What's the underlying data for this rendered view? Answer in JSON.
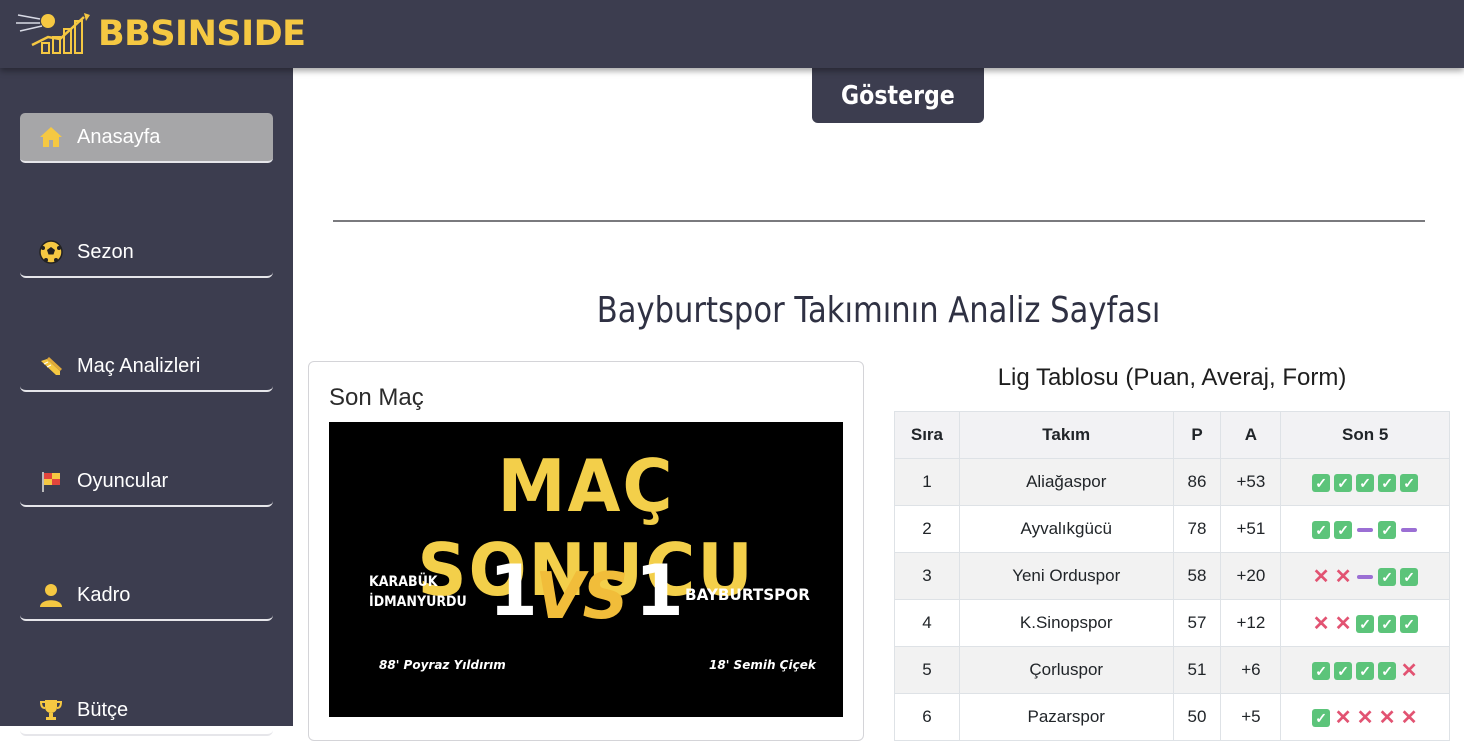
{
  "brand": {
    "name": "BBSINSIDE"
  },
  "colors": {
    "bar": "#3c3d4f",
    "brand": "#f5c842",
    "active": "#a6a6a8",
    "win": "#5cc47a",
    "loss": "#e25372",
    "draw": "#9b6fd4"
  },
  "sidebar": {
    "items": [
      {
        "label": "Anasayfa",
        "icon": "home-icon",
        "active": true
      },
      {
        "label": "Sezon",
        "icon": "soccer-ball-icon",
        "active": false
      },
      {
        "label": "Maç Analizleri",
        "icon": "cleat-icon",
        "active": false
      },
      {
        "label": "Oyuncular",
        "icon": "flag-icon",
        "active": false
      },
      {
        "label": "Kadro",
        "icon": "person-icon",
        "active": false
      },
      {
        "label": "Bütçe",
        "icon": "trophy-icon",
        "active": false
      }
    ]
  },
  "main": {
    "tab": "Gösterge",
    "title": "Bayburtspor Takımının Analiz Sayfası"
  },
  "last_match": {
    "card_title": "Son Maç",
    "header": "MAÇ SONUCU",
    "home_team": "KARABÜK\nİDMANYURDU",
    "home_score": "1",
    "vs": "VS",
    "away_score": "1",
    "away_team": "BAYBURTSPOR",
    "home_scorer": "88' Poyraz Yıldırım",
    "away_scorer": "18' Semih Çiçek"
  },
  "league_table": {
    "title": "Lig Tablosu (Puan, Averaj, Form)",
    "columns": [
      "Sıra",
      "Takım",
      "P",
      "A",
      "Son 5"
    ],
    "rows": [
      {
        "rank": "1",
        "team": "Aliağaspor",
        "points": "86",
        "average": "+53",
        "form": [
          "W",
          "W",
          "W",
          "W",
          "W"
        ]
      },
      {
        "rank": "2",
        "team": "Ayvalıkgücü",
        "points": "78",
        "average": "+51",
        "form": [
          "W",
          "W",
          "D",
          "W",
          "D"
        ]
      },
      {
        "rank": "3",
        "team": "Yeni Orduspor",
        "points": "58",
        "average": "+20",
        "form": [
          "L",
          "L",
          "D",
          "W",
          "W"
        ]
      },
      {
        "rank": "4",
        "team": "K.Sinopspor",
        "points": "57",
        "average": "+12",
        "form": [
          "L",
          "L",
          "W",
          "W",
          "W"
        ]
      },
      {
        "rank": "5",
        "team": "Çorluspor",
        "points": "51",
        "average": "+6",
        "form": [
          "W",
          "W",
          "W",
          "W",
          "L"
        ]
      },
      {
        "rank": "6",
        "team": "Pazarspor",
        "points": "50",
        "average": "+5",
        "form": [
          "W",
          "L",
          "L",
          "L",
          "L"
        ]
      }
    ]
  }
}
